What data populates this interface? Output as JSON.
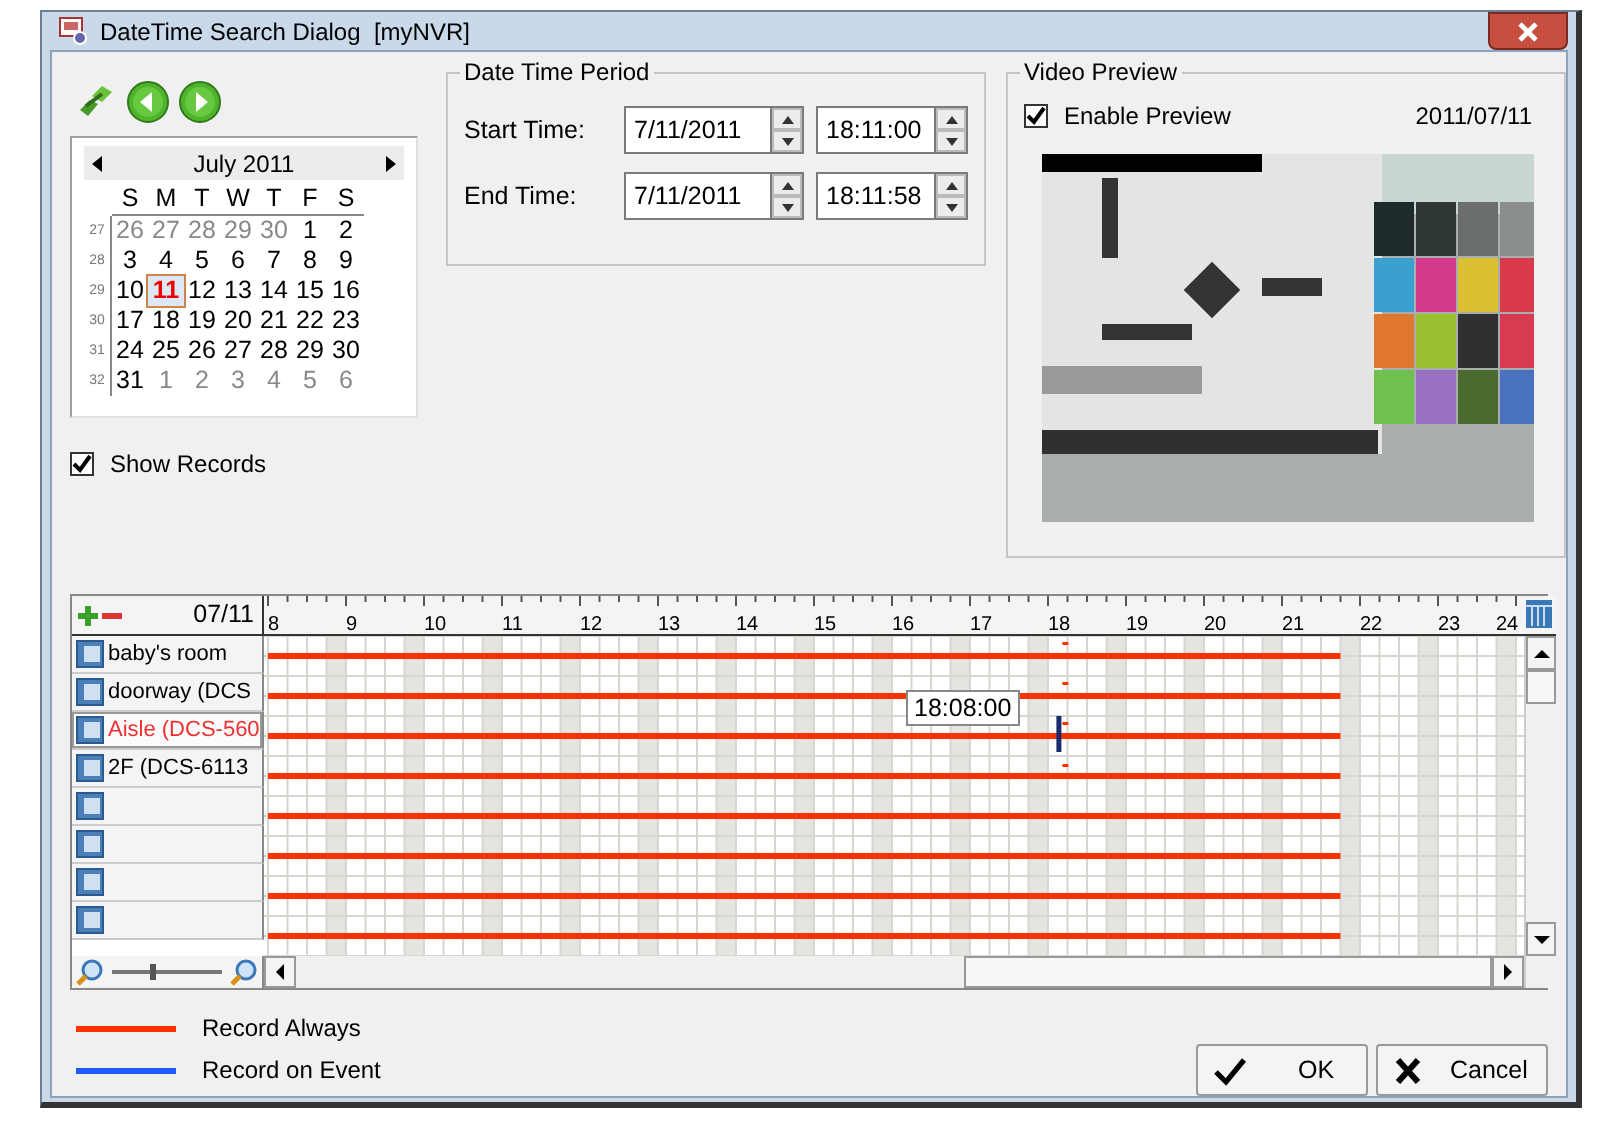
{
  "window": {
    "title": "DateTime Search Dialog  [myNVR]"
  },
  "calendar": {
    "month": "July 2011",
    "weekdays": [
      "S",
      "M",
      "T",
      "W",
      "T",
      "F",
      "S"
    ],
    "weeks": [
      {
        "number": "27",
        "days": [
          {
            "day": "26",
            "outside": true,
            "selected": false
          },
          {
            "day": "27",
            "outside": true,
            "selected": false
          },
          {
            "day": "28",
            "outside": true,
            "selected": false
          },
          {
            "day": "29",
            "outside": true,
            "selected": false
          },
          {
            "day": "30",
            "outside": true,
            "selected": false
          },
          {
            "day": "1",
            "outside": false,
            "selected": false
          },
          {
            "day": "2",
            "outside": false,
            "selected": false
          }
        ]
      },
      {
        "number": "28",
        "days": [
          {
            "day": "3",
            "outside": false,
            "selected": false
          },
          {
            "day": "4",
            "outside": false,
            "selected": false
          },
          {
            "day": "5",
            "outside": false,
            "selected": false
          },
          {
            "day": "6",
            "outside": false,
            "selected": false
          },
          {
            "day": "7",
            "outside": false,
            "selected": false
          },
          {
            "day": "8",
            "outside": false,
            "selected": false
          },
          {
            "day": "9",
            "outside": false,
            "selected": false
          }
        ]
      },
      {
        "number": "29",
        "days": [
          {
            "day": "10",
            "outside": false,
            "selected": false
          },
          {
            "day": "11",
            "outside": false,
            "selected": true
          },
          {
            "day": "12",
            "outside": false,
            "selected": false
          },
          {
            "day": "13",
            "outside": false,
            "selected": false
          },
          {
            "day": "14",
            "outside": false,
            "selected": false
          },
          {
            "day": "15",
            "outside": false,
            "selected": false
          },
          {
            "day": "16",
            "outside": false,
            "selected": false
          }
        ]
      },
      {
        "number": "30",
        "days": [
          {
            "day": "17",
            "outside": false,
            "selected": false
          },
          {
            "day": "18",
            "outside": false,
            "selected": false
          },
          {
            "day": "19",
            "outside": false,
            "selected": false
          },
          {
            "day": "20",
            "outside": false,
            "selected": false
          },
          {
            "day": "21",
            "outside": false,
            "selected": false
          },
          {
            "day": "22",
            "outside": false,
            "selected": false
          },
          {
            "day": "23",
            "outside": false,
            "selected": false
          }
        ]
      },
      {
        "number": "31",
        "days": [
          {
            "day": "24",
            "outside": false,
            "selected": false
          },
          {
            "day": "25",
            "outside": false,
            "selected": false
          },
          {
            "day": "26",
            "outside": false,
            "selected": false
          },
          {
            "day": "27",
            "outside": false,
            "selected": false
          },
          {
            "day": "28",
            "outside": false,
            "selected": false
          },
          {
            "day": "29",
            "outside": false,
            "selected": false
          },
          {
            "day": "30",
            "outside": false,
            "selected": false
          }
        ]
      },
      {
        "number": "32",
        "days": [
          {
            "day": "31",
            "outside": false,
            "selected": false
          },
          {
            "day": "1",
            "outside": true,
            "selected": false
          },
          {
            "day": "2",
            "outside": true,
            "selected": false
          },
          {
            "day": "3",
            "outside": true,
            "selected": false
          },
          {
            "day": "4",
            "outside": true,
            "selected": false
          },
          {
            "day": "5",
            "outside": true,
            "selected": false
          },
          {
            "day": "6",
            "outside": true,
            "selected": false
          }
        ]
      }
    ]
  },
  "show_records": {
    "label": "Show Records",
    "checked": true
  },
  "period": {
    "title": "Date Time Period",
    "rows": [
      {
        "label": "Start Time:",
        "date": "7/11/2011",
        "time": "18:11:00"
      },
      {
        "label": "End Time:",
        "date": "7/11/2011",
        "time": "18:11:58"
      }
    ]
  },
  "preview": {
    "title": "Video Preview",
    "enable": {
      "label": "Enable Preview",
      "checked": true
    },
    "date": "2011/07/11"
  },
  "timeline": {
    "date": "07/11",
    "hours": [
      "8",
      "9",
      "10",
      "11",
      "12",
      "13",
      "14",
      "15",
      "16",
      "17",
      "18",
      "19",
      "20",
      "21",
      "22",
      "23",
      "24"
    ],
    "channels": [
      {
        "name": "baby's room",
        "selected": false,
        "kind": "always"
      },
      {
        "name": "doorway (DCS",
        "selected": false,
        "kind": "always"
      },
      {
        "name": "Aisle (DCS-560",
        "selected": true,
        "kind": "always"
      },
      {
        "name": "2F (DCS-6113",
        "selected": false,
        "kind": "always"
      },
      {
        "selected": false,
        "kind": "always"
      },
      {
        "selected": false,
        "kind": "always"
      },
      {
        "selected": false,
        "kind": "always"
      },
      {
        "selected": false,
        "kind": "always"
      }
    ],
    "cursor_time": "18:08:00",
    "zoom": {
      "level": 0.35
    }
  },
  "legend": [
    {
      "kind": "always",
      "label": "Record Always",
      "color": "#ff3300"
    },
    {
      "kind": "event",
      "label": "Record on Event",
      "color": "#1a5cff"
    }
  ],
  "buttons": [
    {
      "kind": "ok",
      "label": "OK"
    },
    {
      "kind": "cancel",
      "label": "Cancel"
    }
  ]
}
